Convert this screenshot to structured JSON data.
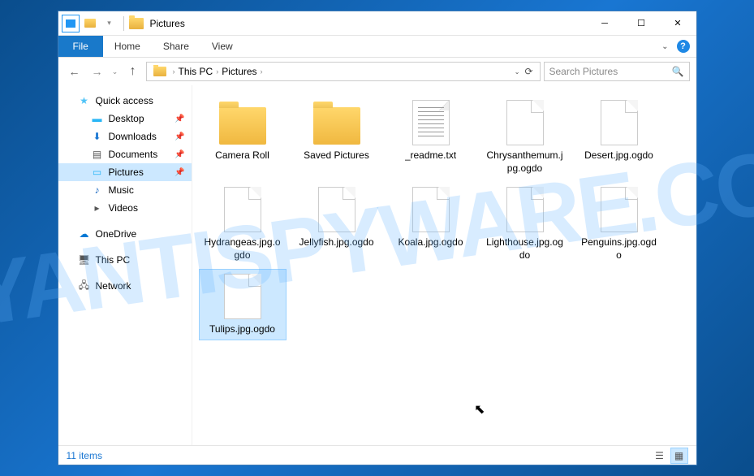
{
  "window": {
    "title": "Pictures"
  },
  "ribbon": {
    "file": "File",
    "tabs": [
      "Home",
      "Share",
      "View"
    ]
  },
  "breadcrumb": {
    "items": [
      "This PC",
      "Pictures"
    ]
  },
  "search": {
    "placeholder": "Search Pictures"
  },
  "sidebar": {
    "quick_access": "Quick access",
    "desktop": "Desktop",
    "downloads": "Downloads",
    "documents": "Documents",
    "pictures": "Pictures",
    "music": "Music",
    "videos": "Videos",
    "onedrive": "OneDrive",
    "this_pc": "This PC",
    "network": "Network"
  },
  "items": [
    {
      "name": "Camera Roll",
      "type": "folder"
    },
    {
      "name": "Saved Pictures",
      "type": "folder"
    },
    {
      "name": "_readme.txt",
      "type": "text"
    },
    {
      "name": "Chrysanthemum.jpg.ogdo",
      "type": "file"
    },
    {
      "name": "Desert.jpg.ogdo",
      "type": "file"
    },
    {
      "name": "Hydrangeas.jpg.ogdo",
      "type": "file"
    },
    {
      "name": "Jellyfish.jpg.ogdo",
      "type": "file"
    },
    {
      "name": "Koala.jpg.ogdo",
      "type": "file"
    },
    {
      "name": "Lighthouse.jpg.ogdo",
      "type": "file"
    },
    {
      "name": "Penguins.jpg.ogdo",
      "type": "file"
    },
    {
      "name": "Tulips.jpg.ogdo",
      "type": "file",
      "selected": true
    }
  ],
  "status": {
    "count": "11 items"
  }
}
